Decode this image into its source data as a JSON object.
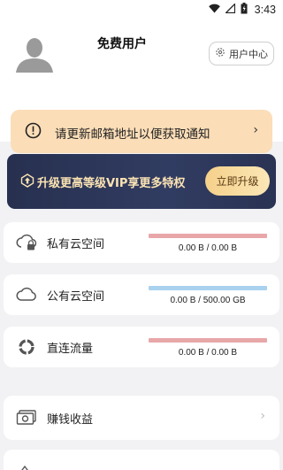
{
  "status_bar": {
    "time": "3:43"
  },
  "header": {
    "username": "免费用户",
    "user_center_label": "用户中心"
  },
  "notice": {
    "text": "请更新邮箱地址以便获取通知"
  },
  "vip_banner": {
    "text": "升级更高等级VIP享更多特权",
    "button_label": "立即升级"
  },
  "storage": [
    {
      "label": "私有云空间",
      "usage": "0.00 B / 0.00 B",
      "color": "#e8a7a9"
    },
    {
      "label": "公有云空间",
      "usage": "0.00 B / 500.00 GB",
      "color": "#a9d2ef"
    },
    {
      "label": "直连流量",
      "usage": "0.00 B / 0.00 B",
      "color": "#e8a7a9"
    }
  ],
  "menu": [
    {
      "label": "赚钱收益"
    }
  ]
}
